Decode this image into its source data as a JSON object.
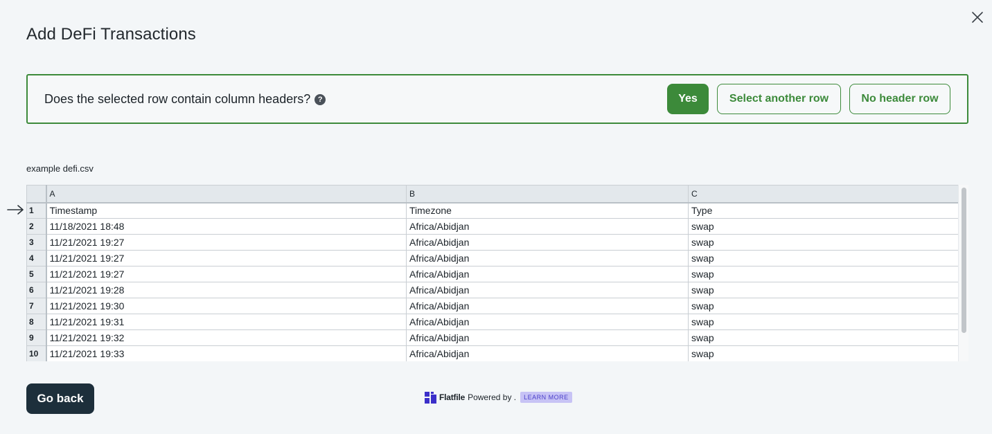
{
  "dialog": {
    "title": "Add DeFi Transactions"
  },
  "header_prompt": {
    "question": "Does the selected row contain column headers?",
    "help_glyph": "?",
    "yes_label": "Yes",
    "select_another_label": "Select another row",
    "no_header_label": "No header row"
  },
  "file": {
    "name": "example defi.csv"
  },
  "grid": {
    "columns": [
      "A",
      "B",
      "C"
    ],
    "rows": [
      {
        "num": "1",
        "cells": [
          "Timestamp",
          "Timezone",
          "Type"
        ]
      },
      {
        "num": "2",
        "cells": [
          "11/18/2021 18:48",
          "Africa/Abidjan",
          "swap"
        ]
      },
      {
        "num": "3",
        "cells": [
          "11/21/2021 19:27",
          "Africa/Abidjan",
          "swap"
        ]
      },
      {
        "num": "4",
        "cells": [
          "11/21/2021 19:27",
          "Africa/Abidjan",
          "swap"
        ]
      },
      {
        "num": "5",
        "cells": [
          "11/21/2021 19:27",
          "Africa/Abidjan",
          "swap"
        ]
      },
      {
        "num": "6",
        "cells": [
          "11/21/2021 19:28",
          "Africa/Abidjan",
          "swap"
        ]
      },
      {
        "num": "7",
        "cells": [
          "11/21/2021 19:30",
          "Africa/Abidjan",
          "swap"
        ]
      },
      {
        "num": "8",
        "cells": [
          "11/21/2021 19:31",
          "Africa/Abidjan",
          "swap"
        ]
      },
      {
        "num": "9",
        "cells": [
          "11/21/2021 19:32",
          "Africa/Abidjan",
          "swap"
        ]
      },
      {
        "num": "10",
        "cells": [
          "11/21/2021 19:33",
          "Africa/Abidjan",
          "swap"
        ]
      }
    ],
    "selected_row": "1"
  },
  "footer": {
    "go_back_label": "Go back",
    "brand": "Flatfile",
    "powered_text": "Powered by .",
    "learn_more_label": "LEARN MORE"
  },
  "colors": {
    "accent_green": "#3c8a3a",
    "dark_button": "#1d2f3b",
    "learn_more_bg": "#c7c3f5"
  },
  "icons": {
    "close": "close-icon",
    "help": "help-icon",
    "row_pointer": "arrow-right-icon",
    "logo": "flatfile-logo-icon"
  }
}
